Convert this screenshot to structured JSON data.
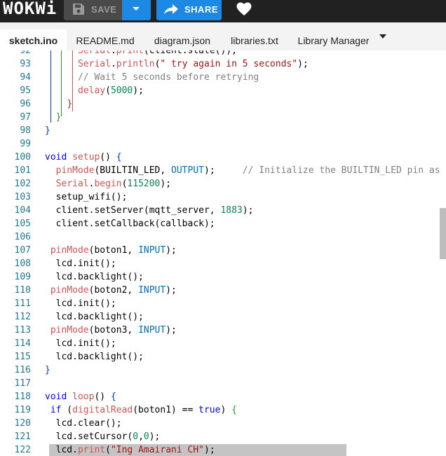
{
  "header": {
    "logo": "WOKWi",
    "save_label": "SAVE",
    "share_label": "SHARE",
    "colors": {
      "bar": "#212121",
      "accent": "#1e88e5",
      "save_bg": "#4a4a4a"
    }
  },
  "tabs": [
    {
      "label": "sketch.ino",
      "active": true
    },
    {
      "label": "README.md",
      "active": false
    },
    {
      "label": "diagram.json",
      "active": false
    },
    {
      "label": "libraries.txt",
      "active": false
    },
    {
      "label": "Library Manager",
      "active": false
    }
  ],
  "editor": {
    "lines": [
      {
        "n": "92",
        "tokens": [
          [
            "      ",
            ""
          ],
          [
            "Serial",
            "fn"
          ],
          [
            ".",
            ""
          ],
          [
            "print",
            "fn"
          ],
          [
            "(client.state());",
            ""
          ]
        ]
      },
      {
        "n": "93",
        "tokens": [
          [
            "      ",
            ""
          ],
          [
            "Serial",
            "fn"
          ],
          [
            ".",
            ""
          ],
          [
            "println",
            "fn"
          ],
          [
            "(",
            ""
          ],
          [
            "\" try again in 5 seconds\"",
            "str"
          ],
          [
            ");",
            ""
          ]
        ]
      },
      {
        "n": "94",
        "tokens": [
          [
            "      ",
            ""
          ],
          [
            "// Wait 5 seconds before retrying",
            "com"
          ]
        ]
      },
      {
        "n": "95",
        "tokens": [
          [
            "      ",
            ""
          ],
          [
            "delay",
            "fn"
          ],
          [
            "(",
            ""
          ],
          [
            "5000",
            "num"
          ],
          [
            ");",
            ""
          ]
        ]
      },
      {
        "n": "96",
        "tokens": [
          [
            "    ",
            ""
          ],
          [
            "}",
            "br3"
          ]
        ]
      },
      {
        "n": "97",
        "tokens": [
          [
            "  ",
            ""
          ],
          [
            "}",
            "br2"
          ]
        ]
      },
      {
        "n": "98",
        "tokens": [
          [
            "",
            ""
          ],
          [
            "}",
            "br"
          ]
        ]
      },
      {
        "n": "99",
        "tokens": []
      },
      {
        "n": "100",
        "tokens": [
          [
            "",
            ""
          ],
          [
            "void",
            "kw"
          ],
          [
            " ",
            ""
          ],
          [
            "setup",
            "fn"
          ],
          [
            "() ",
            ""
          ],
          [
            "{",
            "br"
          ]
        ]
      },
      {
        "n": "101",
        "tokens": [
          [
            "  ",
            ""
          ],
          [
            "pinMode",
            "fn"
          ],
          [
            "(BUILTIN_LED, ",
            ""
          ],
          [
            "OUTPUT",
            "const"
          ],
          [
            ");     ",
            ""
          ],
          [
            "// Initialize the BUILTIN_LED pin as an output",
            "com"
          ]
        ]
      },
      {
        "n": "102",
        "tokens": [
          [
            "  ",
            ""
          ],
          [
            "Serial",
            "fn"
          ],
          [
            ".",
            ""
          ],
          [
            "begin",
            "fn"
          ],
          [
            "(",
            ""
          ],
          [
            "115200",
            "num"
          ],
          [
            ");",
            ""
          ]
        ]
      },
      {
        "n": "103",
        "tokens": [
          [
            "  setup_wifi();",
            ""
          ]
        ]
      },
      {
        "n": "104",
        "tokens": [
          [
            "  client.setServer(mqtt_server, ",
            ""
          ],
          [
            "1883",
            "num"
          ],
          [
            ");",
            ""
          ]
        ]
      },
      {
        "n": "105",
        "tokens": [
          [
            "  client.setCallback(callback);",
            ""
          ]
        ]
      },
      {
        "n": "106",
        "tokens": []
      },
      {
        "n": "107",
        "tokens": [
          [
            " ",
            ""
          ],
          [
            "pinMode",
            "fn"
          ],
          [
            "(boton1, ",
            ""
          ],
          [
            "INPUT",
            "const"
          ],
          [
            ");",
            ""
          ]
        ]
      },
      {
        "n": "108",
        "tokens": [
          [
            "  lcd.init();",
            ""
          ]
        ]
      },
      {
        "n": "109",
        "tokens": [
          [
            "  lcd.backlight();",
            ""
          ]
        ]
      },
      {
        "n": "110",
        "tokens": [
          [
            " ",
            ""
          ],
          [
            "pinMode",
            "fn"
          ],
          [
            "(boton2, ",
            ""
          ],
          [
            "INPUT",
            "const"
          ],
          [
            ");",
            ""
          ]
        ]
      },
      {
        "n": "111",
        "tokens": [
          [
            "  lcd.init();",
            ""
          ]
        ]
      },
      {
        "n": "112",
        "tokens": [
          [
            "  lcd.backlight();",
            ""
          ]
        ]
      },
      {
        "n": "113",
        "tokens": [
          [
            " ",
            ""
          ],
          [
            "pinMode",
            "fn"
          ],
          [
            "(boton3, ",
            ""
          ],
          [
            "INPUT",
            "const"
          ],
          [
            ");",
            ""
          ]
        ]
      },
      {
        "n": "114",
        "tokens": [
          [
            "  lcd.init();",
            ""
          ]
        ]
      },
      {
        "n": "115",
        "tokens": [
          [
            "  lcd.backlight();",
            ""
          ]
        ]
      },
      {
        "n": "116",
        "tokens": [
          [
            "",
            ""
          ],
          [
            "}",
            "br"
          ]
        ]
      },
      {
        "n": "117",
        "tokens": []
      },
      {
        "n": "118",
        "tokens": [
          [
            "",
            ""
          ],
          [
            "void",
            "kw"
          ],
          [
            " ",
            ""
          ],
          [
            "loop",
            "fn"
          ],
          [
            "() ",
            ""
          ],
          [
            "{",
            "br"
          ]
        ]
      },
      {
        "n": "119",
        "tokens": [
          [
            " ",
            ""
          ],
          [
            "if",
            "kw"
          ],
          [
            " (",
            ""
          ],
          [
            "digitalRead",
            "fn"
          ],
          [
            "(boton1) == ",
            ""
          ],
          [
            "true",
            "kw"
          ],
          [
            ") ",
            ""
          ],
          [
            "{",
            "br2"
          ]
        ]
      },
      {
        "n": "120",
        "tokens": [
          [
            "  lcd.clear();",
            ""
          ]
        ]
      },
      {
        "n": "121",
        "tokens": [
          [
            "  lcd.setCursor(",
            ""
          ],
          [
            "0",
            "num"
          ],
          [
            ",",
            ""
          ],
          [
            "0",
            "num"
          ],
          [
            ");",
            ""
          ]
        ]
      },
      {
        "n": "122",
        "tokens": [
          [
            "  lcd.",
            ""
          ],
          [
            "print",
            "fn"
          ],
          [
            "(",
            ""
          ],
          [
            "\"Ing Amairani CH\"",
            "str"
          ],
          [
            ");",
            ""
          ]
        ]
      }
    ]
  }
}
